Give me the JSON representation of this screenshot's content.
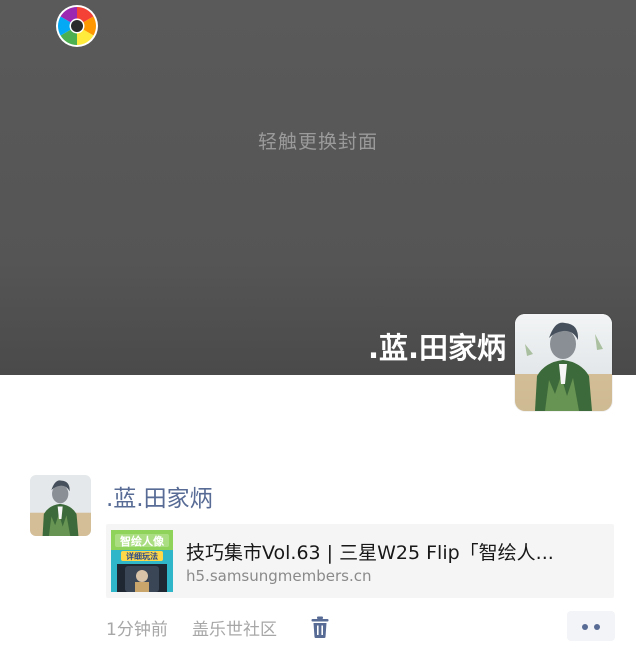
{
  "cover": {
    "hint": "轻触更换封面",
    "username": ".蓝.田家炳",
    "camera_icon": "colorful-camera-shutter-icon",
    "avatar_icon": "user-avatar-photo"
  },
  "post": {
    "author": ".蓝.田家炳",
    "link": {
      "title": "技巧集市Vol.63 | 三星W25 Flip「智绘人...",
      "url": "h5.samsungmembers.cn",
      "thumb_title": "智绘人像",
      "thumb_subtitle": "详细玩法"
    },
    "time": "1分钟前",
    "source": "盖乐世社区",
    "delete_icon": "trash-icon",
    "more_icon": "more-dots-icon"
  },
  "colors": {
    "name_blue": "#576b95",
    "cover_gray": "#555555",
    "meta_gray": "#a7a7a7"
  }
}
